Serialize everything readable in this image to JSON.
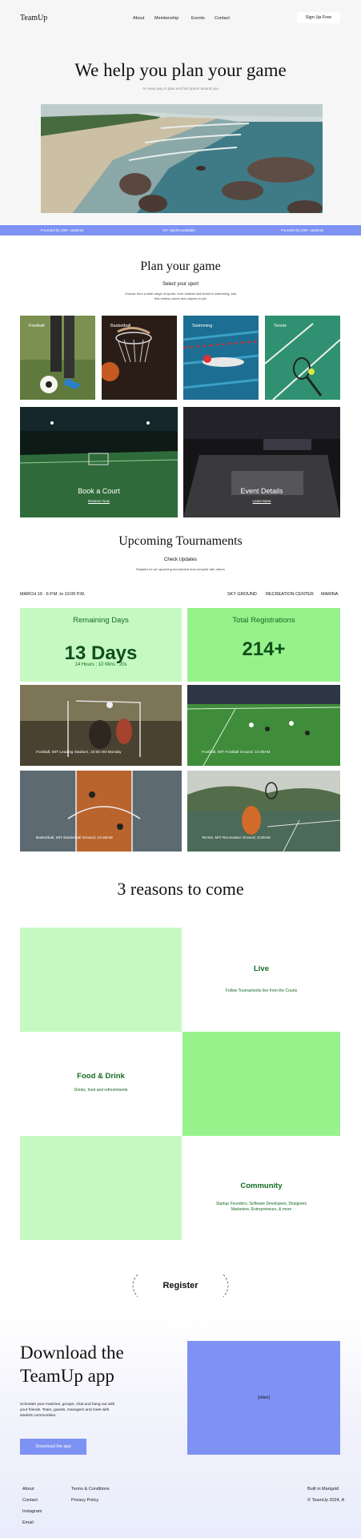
{
  "nav": {
    "logo": "TeamUp",
    "links": [
      "About",
      "Membership",
      "Events",
      "Contact"
    ],
    "signup": "Sign Up Free"
  },
  "hero": {
    "title": "We help you plan your game",
    "subtitle": "An easy way to plan and find sports around you"
  },
  "band": {
    "left": "Founded by 200+ students",
    "center": "10+ Sports available",
    "right": "Founded by 200+ students"
  },
  "plan": {
    "title": "Plan your game",
    "subtitle": "Select your sport",
    "description_1": "Choose from a wide range of sports, from football and tennis to swimming, and",
    "description_2": "find nearby courts and players to join",
    "sports": [
      "Football",
      "Basketball",
      "Swimming",
      "Tennis"
    ],
    "book": {
      "title": "Book a Court",
      "link": "Reserve Now"
    },
    "event": {
      "title": "Event Details",
      "link": "Learn More"
    }
  },
  "upcoming": {
    "title": "Upcoming Tournaments",
    "subtitle": "Check Updates",
    "description": "Register for an upcoming tournament and compete with others",
    "info": {
      "date": "MARCH 19 · 6 P.M. to 10:00 P.M.",
      "venue": "SKY GROUND",
      "center": "RECREATION CENTER",
      "city": "MARINA"
    },
    "remaining": {
      "title": "Remaining Days",
      "value": "13 Days",
      "sub": "14 Hours : 10 Mins : 20s"
    },
    "registrations": {
      "title": "Total Registrations",
      "value": "214+"
    },
    "tournaments": [
      "Football, MIT Leading Stadium, 10:00 AM Monday",
      "Football, MIT Football Ground, 10:30AM",
      "Basketball, MIT Basketball Ground, 10:45AM",
      "Tennis, MIT Recreation Ground, 5:00AM"
    ]
  },
  "reasons": {
    "title": "3 reasons to come",
    "items": [
      {
        "title": "Live",
        "sub1": "Follow Tournaments live from the Courts",
        "sub2": ""
      },
      {
        "title": "Food & Drink",
        "sub1": "Drinks, food and refreshments",
        "sub2": ""
      },
      {
        "title": "Community",
        "sub1": "Startup Founders, Software Developers, Designers",
        "sub2": "Marketers, Entrepreneurs, & more"
      }
    ]
  },
  "register": {
    "label": "Register"
  },
  "download": {
    "title_line1": "Download the",
    "title_line2": "TeamUp app",
    "desc_1": "Schedule your matches, groups, chat and hang out with",
    "desc_2": "your friends. Team, guests, managers and meet with",
    "desc_3": "student communities.",
    "button": "Download the app",
    "image_placeholder": "[video]"
  },
  "footer": {
    "col1": [
      "About",
      "Contact",
      "Instagram",
      "Email"
    ],
    "col2": [
      "Terms & Conditions",
      "Privacy Policy"
    ],
    "right1": "Built in Marigold",
    "right2": "© TeamUp 2024, A"
  },
  "colors": {
    "accent": "#7e92f4",
    "light_green": "#c6f9c2",
    "green": "#98f28c",
    "dark_green": "#146b23"
  }
}
